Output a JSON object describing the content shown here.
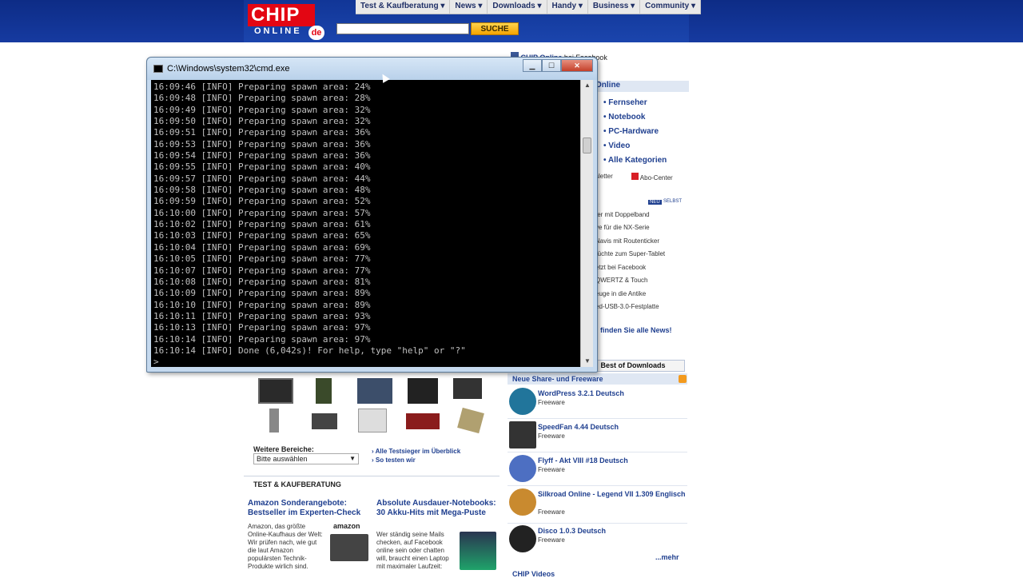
{
  "nav": [
    "Test & Kaufberatung",
    "News",
    "Downloads",
    "Handy",
    "Business",
    "Community"
  ],
  "logo": {
    "chip": "CHIP",
    "online": "ONLINE",
    "de": "de"
  },
  "search": {
    "button": "SUCHE"
  },
  "cmd": {
    "title": "C:\\Windows\\system32\\cmd.exe",
    "lines": [
      "16:09:46 [INFO] Preparing spawn area: 24%",
      "16:09:48 [INFO] Preparing spawn area: 28%",
      "16:09:49 [INFO] Preparing spawn area: 32%",
      "16:09:50 [INFO] Preparing spawn area: 32%",
      "16:09:51 [INFO] Preparing spawn area: 36%",
      "16:09:53 [INFO] Preparing spawn area: 36%",
      "16:09:54 [INFO] Preparing spawn area: 36%",
      "16:09:55 [INFO] Preparing spawn area: 40%",
      "16:09:57 [INFO] Preparing spawn area: 44%",
      "16:09:58 [INFO] Preparing spawn area: 48%",
      "16:09:59 [INFO] Preparing spawn area: 52%",
      "16:10:00 [INFO] Preparing spawn area: 57%",
      "16:10:02 [INFO] Preparing spawn area: 61%",
      "16:10:03 [INFO] Preparing spawn area: 65%",
      "16:10:04 [INFO] Preparing spawn area: 69%",
      "16:10:05 [INFO] Preparing spawn area: 77%",
      "16:10:07 [INFO] Preparing spawn area: 77%",
      "16:10:08 [INFO] Preparing spawn area: 81%",
      "16:10:09 [INFO] Preparing spawn area: 89%",
      "16:10:10 [INFO] Preparing spawn area: 89%",
      "16:10:11 [INFO] Preparing spawn area: 93%",
      "16:10:13 [INFO] Preparing spawn area: 97%",
      "16:10:14 [INFO] Preparing spawn area: 97%",
      "16:10:14 [INFO] Done (6,042s)! For help, type \"help\" or \"?\"",
      ">"
    ]
  },
  "right": {
    "fb": {
      "name": "CHIP Online",
      "suffix": " bei Facebook"
    },
    "panel_head": "Online",
    "categories": [
      "Fernseher",
      "Notebook",
      "PC-Hardware",
      "Video",
      "Alle Kategorien"
    ],
    "newsletter": "sletter",
    "abo": "Abo-Center",
    "neu": "NEU",
    "selbst": "SELBST",
    "news": [
      "ter mit Doppelband",
      "ve für die NX-Serie",
      "Navis mit Routenticker",
      "rüchte zum Super-Tablet",
      "etzt bei Facebook",
      "QWERTZ & Touch",
      "euge in die Antike",
      "ed-USB-3.0-Festplatte"
    ],
    "news_all": "finden Sie alle News!",
    "best_tab": "Best of Downloads",
    "share_head": "Neue Share- und Freeware",
    "downloads": [
      {
        "title": "WordPress 3.2.1 Deutsch",
        "type": "Freeware"
      },
      {
        "title": "SpeedFan 4.44 Deutsch",
        "type": "Freeware"
      },
      {
        "title": "Flyff - Akt VIII #18 Deutsch",
        "type": "Freeware"
      },
      {
        "title": "Silkroad Online - Legend VII 1.309 Englisch",
        "type": "Freeware"
      },
      {
        "title": "Disco 1.0.3 Deutsch",
        "type": "Freeware"
      }
    ],
    "more": "...mehr",
    "chip_video": "CHIP Videos"
  },
  "left": {
    "weitere_label": "Weitere Bereiche:",
    "select_value": "Bitte auswählen",
    "links": [
      "Alle Testsieger im Überblick",
      "So testen wir"
    ],
    "section_title": "TEST & KAUFBERATUNG",
    "article1": {
      "title": "Amazon Sonderangebote: Bestseller im Experten-Check",
      "text": "Amazon, das größte Online-Kaufhaus der Welt: Wir prüfen nach, wie gut die laut Amazon populärsten Technik-Produkte wirlich sind."
    },
    "amazon_logo": "amazon",
    "article2": {
      "title": "Absolute Ausdauer-Notebooks: 30 Akku-Hits mit Mega-Puste",
      "text": "Wer ständig seine Mails checken, auf Facebook online sein oder chatten will, braucht einen Laptop mit maximaler Laufzeit:"
    }
  },
  "colors": {
    "brand_red": "#e30613",
    "nav_blue": "#1f3f8f",
    "header_blue": "#163aa0"
  }
}
